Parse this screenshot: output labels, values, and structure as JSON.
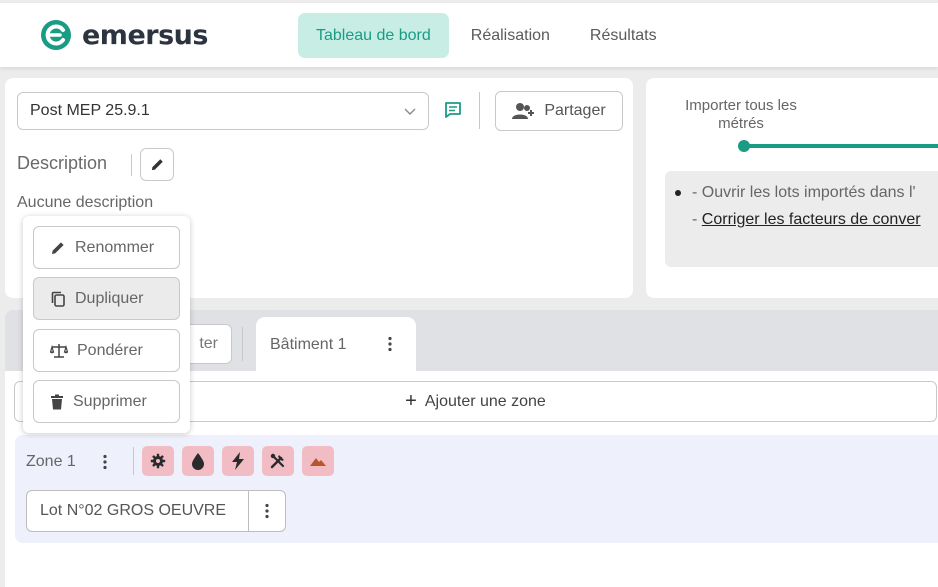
{
  "app": {
    "brand": "emersus",
    "brand_color": "#1a9c84"
  },
  "nav": {
    "tabs": [
      {
        "label": "Tableau de bord",
        "active": true
      },
      {
        "label": "Réalisation",
        "active": false
      },
      {
        "label": "Résultats",
        "active": false
      }
    ]
  },
  "project": {
    "selected_version": "Post MEP 25.9.1",
    "share_label": "Partager",
    "description_label": "Description",
    "description_value": "Aucune description"
  },
  "import_panel": {
    "label": "Importer tous les métrés",
    "info_line1": "- Ouvrir les lots importés dans l'",
    "info_line2_prefix": "- ",
    "info_line2_link": "Corriger les facteurs de conver"
  },
  "context_menu": {
    "items": [
      {
        "label": "Renommer",
        "icon": "pencil-icon"
      },
      {
        "label": "Dupliquer",
        "icon": "copy-icon",
        "hovered": true
      },
      {
        "label": "Pondérer",
        "icon": "scale-icon"
      },
      {
        "label": "Supprimer",
        "icon": "trash-icon"
      }
    ]
  },
  "buildings": {
    "hidden_button_fragment": "ter",
    "active_tab": "Bâtiment 1"
  },
  "zones": {
    "add_label": "Ajouter une zone",
    "zone_label": "Zone 1",
    "tag_icons": [
      "gear-icon",
      "water-drop-icon",
      "lightning-icon",
      "tools-icon",
      "terrain-icon"
    ],
    "tag_color": "#f1bcc4",
    "lot_label": "Lot N°02 GROS OEUVRE"
  }
}
